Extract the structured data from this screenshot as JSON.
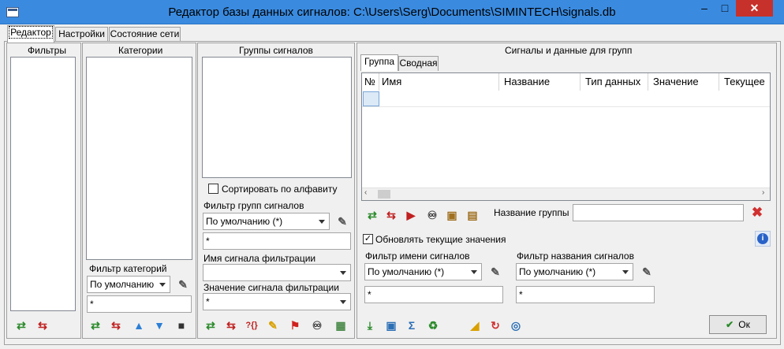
{
  "window": {
    "title": "Редактор базы данных сигналов: C:\\Users\\Serg\\Documents\\SIMINTECH\\signals.db",
    "minimize": "–",
    "maximize": "□",
    "close": "✕"
  },
  "tabs": [
    {
      "label": "Редактор"
    },
    {
      "label": "Настройки"
    },
    {
      "label": "Состояние сети"
    }
  ],
  "filters": {
    "header": "Фильтры"
  },
  "categories": {
    "header": "Категории",
    "filter_label": "Фильтр категорий",
    "filter_value": "По умолчанию",
    "filter_text": "*"
  },
  "groups": {
    "header": "Группы сигналов",
    "sort_label": "Сортировать по алфавиту",
    "filter_label": "Фильтр групп сигналов",
    "filter_value": "По умолчанию (*)",
    "filter_text": "*",
    "signal_name_label": "Имя сигнала фильтрации",
    "signal_value_label": "Значение сигнала фильтрации",
    "signal_value": "*"
  },
  "signals": {
    "header": "Сигналы и данные для групп",
    "subtabs": [
      {
        "label": "Группа"
      },
      {
        "label": "Сводная"
      }
    ],
    "columns": [
      "№",
      "Имя",
      "Название",
      "Тип данных",
      "Значение",
      "Текущее"
    ],
    "group_name_label": "Название группы",
    "update_label": "Обновлять текущие значения",
    "name_filter_label": "Фильтр имени сигналов",
    "name_filter_value": "По умолчанию (*)",
    "name_filter_text": "*",
    "title_filter_label": "Фильтр названия сигналов",
    "title_filter_value": "По умолчанию (*)",
    "title_filter_text": "*"
  },
  "ok_label": "Ок"
}
